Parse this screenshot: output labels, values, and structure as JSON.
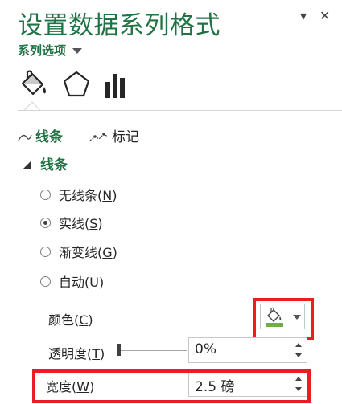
{
  "pane": {
    "title": "设置数据系列格式",
    "pin_glyph": "▾",
    "close_glyph": "✕"
  },
  "series_options": {
    "label": "系列选项"
  },
  "icon_tabs": [
    {
      "icon": "paint-bucket-icon"
    },
    {
      "icon": "pentagon-icon"
    },
    {
      "icon": "bar-chart-icon"
    }
  ],
  "sub_tabs": {
    "line": "线条",
    "marker": "标记"
  },
  "section": {
    "title": "线条"
  },
  "line_options": [
    {
      "text": "无线条(",
      "key": "N",
      "close": ")",
      "selected": false
    },
    {
      "text": "实线(",
      "key": "S",
      "close": ")",
      "selected": true
    },
    {
      "text": "渐变线(",
      "key": "G",
      "close": ")",
      "selected": false
    },
    {
      "text": "自动(",
      "key": "U",
      "close": ")",
      "selected": false
    }
  ],
  "color": {
    "label": "颜色(",
    "key": "C",
    "close": ")",
    "swatch": "#70ad47"
  },
  "transparency": {
    "label": "透明度(",
    "key": "T",
    "close": ")",
    "value": "0%",
    "level": 0
  },
  "width": {
    "label": "宽度(",
    "key": "W",
    "close": ")",
    "value": "2.5 磅"
  },
  "colors": {
    "accent": "#217346",
    "highlight": "#ed1c24"
  }
}
